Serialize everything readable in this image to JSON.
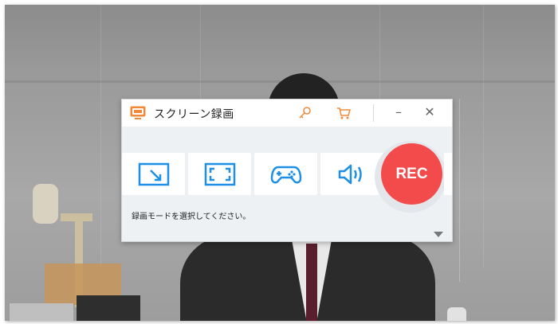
{
  "window": {
    "title": "スクリーン録画",
    "minimize_glyph": "–",
    "close_glyph": "✕"
  },
  "modes": [
    {
      "name": "region-mode",
      "icon": "region-capture-icon"
    },
    {
      "name": "fullscreen-mode",
      "icon": "fullscreen-icon"
    },
    {
      "name": "game-mode",
      "icon": "gamepad-icon"
    },
    {
      "name": "audio-mode",
      "icon": "speaker-icon"
    }
  ],
  "record": {
    "label": "REC"
  },
  "hint": {
    "text": "録画モードを選択してください。"
  },
  "colors": {
    "accent_blue": "#1d8fe6",
    "rec_red": "#f34b4b",
    "icon_orange": "#f08a3a"
  }
}
